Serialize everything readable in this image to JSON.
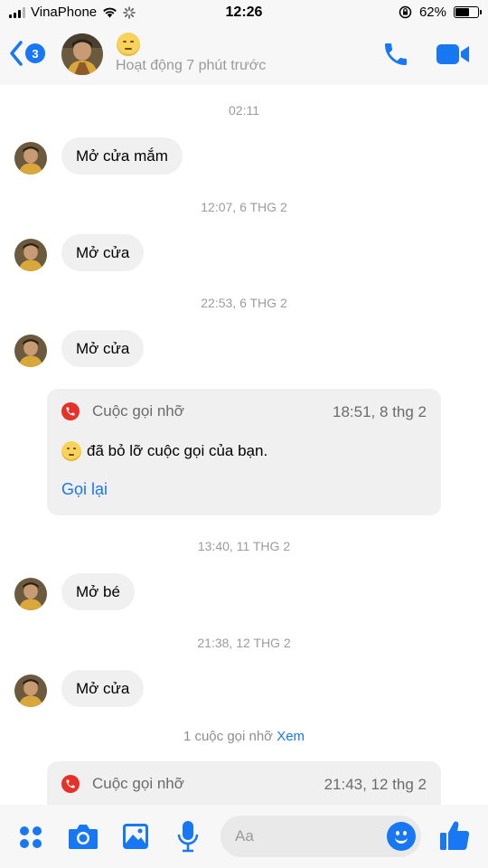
{
  "status_bar": {
    "carrier": "VinaPhone",
    "time": "12:26",
    "battery": "62%",
    "battery_level": 0.62
  },
  "header": {
    "back_count": "3",
    "active_status": "Hoạt động 7 phút trước",
    "accent_color": "#1877f2"
  },
  "messages": [
    {
      "timestamp": "02:11",
      "text": "Mở cửa mắm"
    },
    {
      "timestamp": "12:07, 6 THG 2",
      "text": "Mở cửa"
    },
    {
      "timestamp": "22:53, 6 THG 2",
      "text": "Mở cửa"
    },
    {
      "timestamp": "13:40, 11 THG 2",
      "text": "Mở bé"
    },
    {
      "timestamp": "21:38, 12 THG 2",
      "text": "Mở cửa"
    }
  ],
  "missed_call_1": {
    "title": "Cuộc gọi nhỡ",
    "time": "18:51, 8 thg 2",
    "description": "đã bỏ lỡ cuộc gọi của bạn.",
    "action": "Gọi lại"
  },
  "missed_summary": {
    "text": "1 cuộc gọi nhỡ",
    "link": "Xem"
  },
  "missed_call_2": {
    "title": "Cuộc gọi nhỡ",
    "time": "21:43, 12 thg 2"
  },
  "composer": {
    "placeholder": "Aa"
  },
  "icons": [
    "back-icon",
    "phone-icon",
    "video-camera-icon",
    "missed-call-icon",
    "apps-icon",
    "camera-icon",
    "gallery-icon",
    "microphone-icon",
    "emoji-icon",
    "thumbs-up-icon"
  ]
}
